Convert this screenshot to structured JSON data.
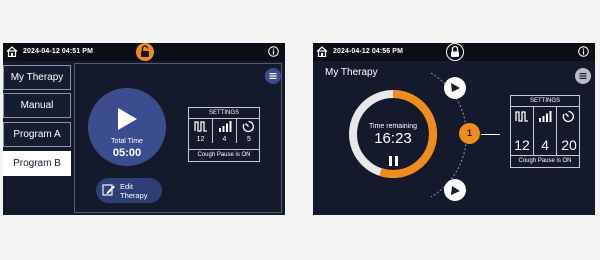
{
  "left": {
    "status": {
      "datetime": "2024-04-12  04:51 PM",
      "home_icon": "home-icon",
      "lock_icon": "lock-open-icon",
      "info_icon": "info-icon"
    },
    "tabs": [
      {
        "label": "My Therapy",
        "active": false
      },
      {
        "label": "Manual",
        "active": false
      },
      {
        "label": "Program A",
        "active": false
      },
      {
        "label": "Program B",
        "active": true
      }
    ],
    "menu_icon": "menu-icon",
    "play": {
      "icon": "play-icon",
      "total_time_label": "Total Time",
      "total_time_value": "05:00"
    },
    "edit": {
      "icon": "edit-icon",
      "label_line1": "Edit",
      "label_line2": "Therapy"
    },
    "settings": {
      "title": "SETTINGS",
      "values": [
        "12",
        "4",
        "5"
      ],
      "icons": [
        "pressure-wave-icon",
        "signal-bars-icon",
        "timer-icon"
      ],
      "footer": "Cough Pause is ON"
    }
  },
  "right": {
    "status": {
      "datetime": "2024-04-12  04:56 PM",
      "home_icon": "home-icon",
      "lock_icon": "lock-closed-icon",
      "info_icon": "info-icon"
    },
    "title": "My Therapy",
    "menu_icon": "menu-icon",
    "ring": {
      "progress_fraction": 0.55,
      "time_remaining_label": "Time remaining",
      "time_remaining_value": "16:23",
      "pause_icon": "pause-icon"
    },
    "arrows": {
      "up_icon": "arrow-up-icon",
      "down_icon": "arrow-down-icon"
    },
    "program_number": "1",
    "settings": {
      "title": "SETTINGS",
      "values": [
        "12",
        "4",
        "20"
      ],
      "icons": [
        "pressure-wave-icon",
        "signal-bars-icon",
        "timer-icon"
      ],
      "footer": "Cough Pause is ON"
    }
  },
  "colors": {
    "screen_bg": "#141a2c",
    "accent": "#f08c1b",
    "play_blue": "#3b4d8e",
    "button_blue": "#2e3e77"
  }
}
